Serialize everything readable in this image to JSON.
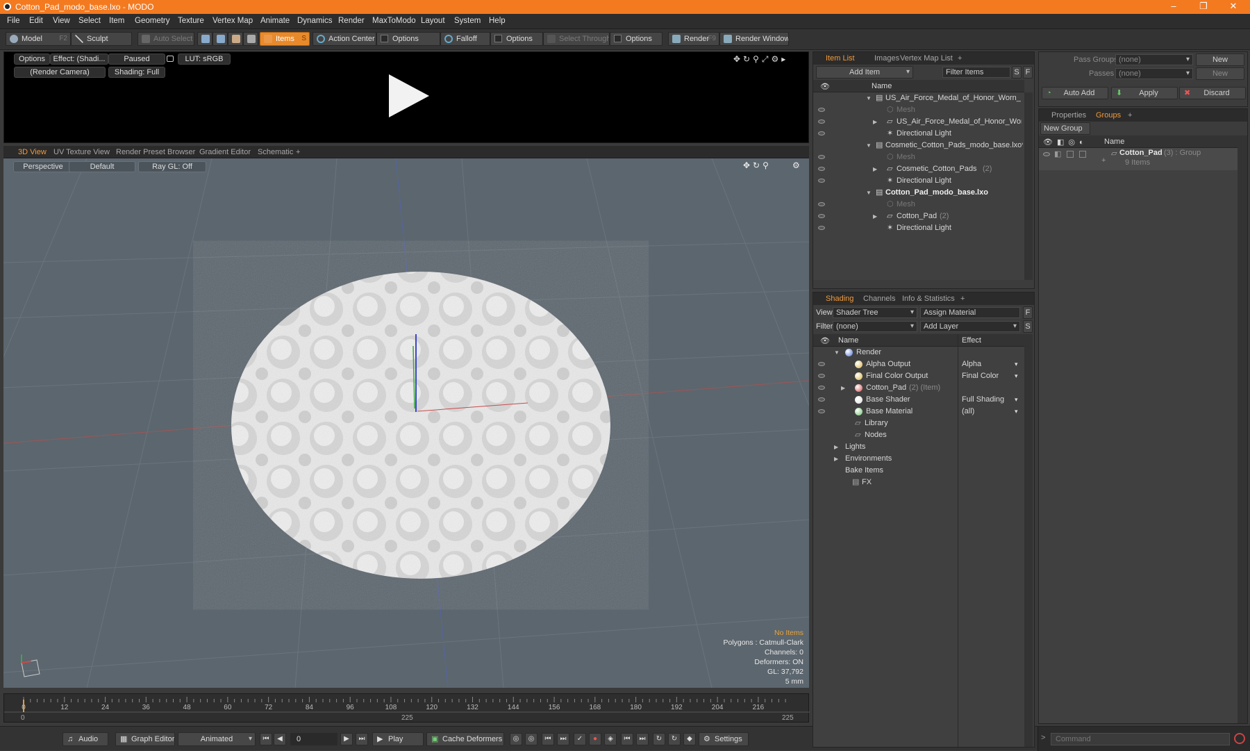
{
  "window": {
    "title": "Cotton_Pad_modo_base.lxo - MODO",
    "minimize": "–",
    "maximize": "❐",
    "close": "✕"
  },
  "menu": [
    "File",
    "Edit",
    "View",
    "Select",
    "Item",
    "Geometry",
    "Texture",
    "Vertex Map",
    "Animate",
    "Dynamics",
    "Render",
    "MaxToModo",
    "Layout",
    "System",
    "Help"
  ],
  "toolbar": {
    "model": "Model",
    "model_key": "F2",
    "sculpt": "Sculpt",
    "auto_select": "Auto Select",
    "items": "Items",
    "items_key": "S",
    "action_center": "Action Center",
    "options1": "Options",
    "falloff": "Falloff",
    "options2": "Options",
    "select_through": "Select Through",
    "options3": "Options",
    "render": "Render",
    "render_key": "F9",
    "render_window": "Render Window"
  },
  "preview": {
    "options": "Options",
    "effect": "Effect: (Shadi...",
    "paused": "Paused",
    "lut": "LUT: sRGB",
    "camera": "(Render Camera)",
    "shading": "Shading: Full"
  },
  "viewport_tabs": [
    "3D View",
    "UV Texture View",
    "Render Preset Browser",
    "Gradient Editor",
    "Schematic",
    "+"
  ],
  "viewport": {
    "perspective": "Perspective",
    "default": "Default",
    "raygl": "Ray GL: Off",
    "stats": {
      "no_items": "No Items",
      "polygons": "Polygons : Catmull-Clark",
      "channels": "Channels: 0",
      "deformers": "Deformers: ON",
      "gl": "GL: 37,792",
      "scale": "5 mm"
    }
  },
  "timeline": {
    "ticks": [
      "0",
      "12",
      "24",
      "36",
      "48",
      "60",
      "72",
      "84",
      "96",
      "108",
      "120",
      "132",
      "144",
      "156",
      "168",
      "180",
      "192",
      "204",
      "216"
    ],
    "start": "0",
    "mid": "225",
    "end": "225"
  },
  "transport": {
    "audio": "Audio",
    "graph_editor": "Graph Editor",
    "animated": "Animated",
    "frame": "0",
    "play": "Play",
    "cache_deformers": "Cache Deformers",
    "settings": "Settings"
  },
  "item_list": {
    "tabs": [
      "Item List",
      "Images",
      "Vertex Map List",
      "+"
    ],
    "add_item": "Add Item",
    "filter_items": "Filter Items",
    "s": "S",
    "f": "F",
    "col_name": "Name",
    "rows": [
      {
        "label": "US_Air_Force_Medal_of_Honor_Worn_ ...",
        "extra": ""
      },
      {
        "label": "Mesh",
        "extra": ""
      },
      {
        "label": "US_Air_Force_Medal_of_Honor_Worn...",
        "extra": ""
      },
      {
        "label": "Directional Light",
        "extra": ""
      },
      {
        "label": "Cosmetic_Cotton_Pads_modo_base.lxo*",
        "extra": ""
      },
      {
        "label": "Mesh",
        "extra": ""
      },
      {
        "label": "Cosmetic_Cotton_Pads",
        "extra": "(2)"
      },
      {
        "label": "Directional Light",
        "extra": ""
      },
      {
        "label": "Cotton_Pad_modo_base.lxo",
        "extra": ""
      },
      {
        "label": "Mesh",
        "extra": ""
      },
      {
        "label": "Cotton_Pad",
        "extra": "(2)"
      },
      {
        "label": "Directional Light",
        "extra": ""
      }
    ]
  },
  "shading": {
    "tabs": [
      "Shading",
      "Channels",
      "Info & Statistics",
      "+"
    ],
    "view_label": "View",
    "view_value": "Shader Tree",
    "assign_material": "Assign Material",
    "filter_label": "Filter",
    "filter_value": "(none)",
    "add_layer": "Add Layer",
    "f": "F",
    "s": "S",
    "col_name": "Name",
    "col_effect": "Effect",
    "rows": [
      {
        "label": "Render",
        "extra": "",
        "effect": ""
      },
      {
        "label": "Alpha Output",
        "extra": "",
        "effect": "Alpha"
      },
      {
        "label": "Final Color Output",
        "extra": "",
        "effect": "Final Color"
      },
      {
        "label": "Cotton_Pad",
        "extra": "(2) (Item)",
        "effect": ""
      },
      {
        "label": "Base Shader",
        "extra": "",
        "effect": "Full Shading"
      },
      {
        "label": "Base Material",
        "extra": "",
        "effect": "(all)"
      },
      {
        "label": "Library",
        "extra": "",
        "effect": ""
      },
      {
        "label": "Nodes",
        "extra": "",
        "effect": ""
      },
      {
        "label": "Lights",
        "extra": "",
        "effect": ""
      },
      {
        "label": "Environments",
        "extra": "",
        "effect": ""
      },
      {
        "label": "Bake Items",
        "extra": "",
        "effect": ""
      },
      {
        "label": "FX",
        "extra": "",
        "effect": ""
      }
    ]
  },
  "passes": {
    "pass_groups": "Pass Groups",
    "passes": "Passes",
    "none": "(none)",
    "new": "New",
    "auto_add": "Auto Add",
    "apply": "Apply",
    "discard": "Discard"
  },
  "groups": {
    "tabs": [
      "Properties",
      "Groups",
      "+"
    ],
    "new_group": "New Group",
    "col_name": "Name",
    "group_name": "Cotton_Pad",
    "group_extra": "(3) : Group",
    "group_items": "9 Items"
  },
  "command": {
    "placeholder": "Command"
  },
  "colors": {
    "accent": "#f39a3a",
    "titlebar": "#f47a20",
    "viewport": "#5c666e",
    "stats": "#e8a33c"
  }
}
